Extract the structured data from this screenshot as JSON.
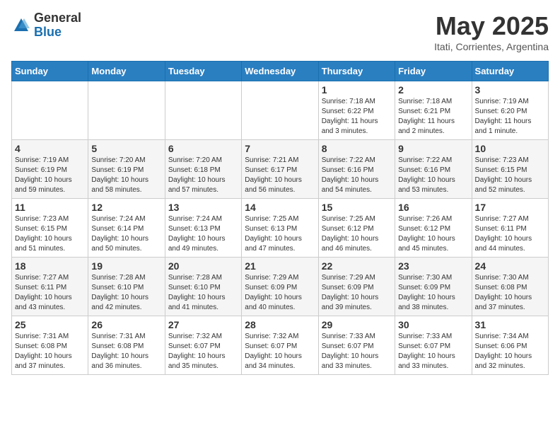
{
  "logo": {
    "general": "General",
    "blue": "Blue"
  },
  "header": {
    "month": "May 2025",
    "location": "Itati, Corrientes, Argentina"
  },
  "weekdays": [
    "Sunday",
    "Monday",
    "Tuesday",
    "Wednesday",
    "Thursday",
    "Friday",
    "Saturday"
  ],
  "weeks": [
    [
      {
        "day": "",
        "info": ""
      },
      {
        "day": "",
        "info": ""
      },
      {
        "day": "",
        "info": ""
      },
      {
        "day": "",
        "info": ""
      },
      {
        "day": "1",
        "info": "Sunrise: 7:18 AM\nSunset: 6:22 PM\nDaylight: 11 hours\nand 3 minutes."
      },
      {
        "day": "2",
        "info": "Sunrise: 7:18 AM\nSunset: 6:21 PM\nDaylight: 11 hours\nand 2 minutes."
      },
      {
        "day": "3",
        "info": "Sunrise: 7:19 AM\nSunset: 6:20 PM\nDaylight: 11 hours\nand 1 minute."
      }
    ],
    [
      {
        "day": "4",
        "info": "Sunrise: 7:19 AM\nSunset: 6:19 PM\nDaylight: 10 hours\nand 59 minutes."
      },
      {
        "day": "5",
        "info": "Sunrise: 7:20 AM\nSunset: 6:19 PM\nDaylight: 10 hours\nand 58 minutes."
      },
      {
        "day": "6",
        "info": "Sunrise: 7:20 AM\nSunset: 6:18 PM\nDaylight: 10 hours\nand 57 minutes."
      },
      {
        "day": "7",
        "info": "Sunrise: 7:21 AM\nSunset: 6:17 PM\nDaylight: 10 hours\nand 56 minutes."
      },
      {
        "day": "8",
        "info": "Sunrise: 7:22 AM\nSunset: 6:16 PM\nDaylight: 10 hours\nand 54 minutes."
      },
      {
        "day": "9",
        "info": "Sunrise: 7:22 AM\nSunset: 6:16 PM\nDaylight: 10 hours\nand 53 minutes."
      },
      {
        "day": "10",
        "info": "Sunrise: 7:23 AM\nSunset: 6:15 PM\nDaylight: 10 hours\nand 52 minutes."
      }
    ],
    [
      {
        "day": "11",
        "info": "Sunrise: 7:23 AM\nSunset: 6:15 PM\nDaylight: 10 hours\nand 51 minutes."
      },
      {
        "day": "12",
        "info": "Sunrise: 7:24 AM\nSunset: 6:14 PM\nDaylight: 10 hours\nand 50 minutes."
      },
      {
        "day": "13",
        "info": "Sunrise: 7:24 AM\nSunset: 6:13 PM\nDaylight: 10 hours\nand 49 minutes."
      },
      {
        "day": "14",
        "info": "Sunrise: 7:25 AM\nSunset: 6:13 PM\nDaylight: 10 hours\nand 47 minutes."
      },
      {
        "day": "15",
        "info": "Sunrise: 7:25 AM\nSunset: 6:12 PM\nDaylight: 10 hours\nand 46 minutes."
      },
      {
        "day": "16",
        "info": "Sunrise: 7:26 AM\nSunset: 6:12 PM\nDaylight: 10 hours\nand 45 minutes."
      },
      {
        "day": "17",
        "info": "Sunrise: 7:27 AM\nSunset: 6:11 PM\nDaylight: 10 hours\nand 44 minutes."
      }
    ],
    [
      {
        "day": "18",
        "info": "Sunrise: 7:27 AM\nSunset: 6:11 PM\nDaylight: 10 hours\nand 43 minutes."
      },
      {
        "day": "19",
        "info": "Sunrise: 7:28 AM\nSunset: 6:10 PM\nDaylight: 10 hours\nand 42 minutes."
      },
      {
        "day": "20",
        "info": "Sunrise: 7:28 AM\nSunset: 6:10 PM\nDaylight: 10 hours\nand 41 minutes."
      },
      {
        "day": "21",
        "info": "Sunrise: 7:29 AM\nSunset: 6:09 PM\nDaylight: 10 hours\nand 40 minutes."
      },
      {
        "day": "22",
        "info": "Sunrise: 7:29 AM\nSunset: 6:09 PM\nDaylight: 10 hours\nand 39 minutes."
      },
      {
        "day": "23",
        "info": "Sunrise: 7:30 AM\nSunset: 6:09 PM\nDaylight: 10 hours\nand 38 minutes."
      },
      {
        "day": "24",
        "info": "Sunrise: 7:30 AM\nSunset: 6:08 PM\nDaylight: 10 hours\nand 37 minutes."
      }
    ],
    [
      {
        "day": "25",
        "info": "Sunrise: 7:31 AM\nSunset: 6:08 PM\nDaylight: 10 hours\nand 37 minutes."
      },
      {
        "day": "26",
        "info": "Sunrise: 7:31 AM\nSunset: 6:08 PM\nDaylight: 10 hours\nand 36 minutes."
      },
      {
        "day": "27",
        "info": "Sunrise: 7:32 AM\nSunset: 6:07 PM\nDaylight: 10 hours\nand 35 minutes."
      },
      {
        "day": "28",
        "info": "Sunrise: 7:32 AM\nSunset: 6:07 PM\nDaylight: 10 hours\nand 34 minutes."
      },
      {
        "day": "29",
        "info": "Sunrise: 7:33 AM\nSunset: 6:07 PM\nDaylight: 10 hours\nand 33 minutes."
      },
      {
        "day": "30",
        "info": "Sunrise: 7:33 AM\nSunset: 6:07 PM\nDaylight: 10 hours\nand 33 minutes."
      },
      {
        "day": "31",
        "info": "Sunrise: 7:34 AM\nSunset: 6:06 PM\nDaylight: 10 hours\nand 32 minutes."
      }
    ]
  ]
}
